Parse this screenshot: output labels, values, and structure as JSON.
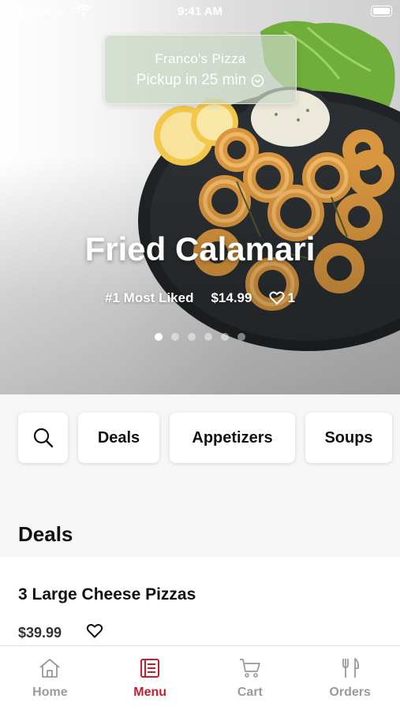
{
  "status_bar": {
    "carrier": "Carrier",
    "time": "9:41 AM"
  },
  "restaurant": {
    "name": "Franco's Pizza",
    "pickup": "Pickup in 25 min"
  },
  "hero": {
    "title": "Fried Calamari",
    "badge": "#1 Most Liked",
    "price": "$14.99",
    "likes": "1",
    "dots": 6,
    "active_dot": 0
  },
  "categories": [
    {
      "icon": "search-icon"
    },
    {
      "label": "Deals"
    },
    {
      "label": "Appetizers"
    },
    {
      "label": "Soups"
    }
  ],
  "section": {
    "title": "Deals"
  },
  "items": [
    {
      "name": "3 Large Cheese Pizzas",
      "price": "$39.99"
    }
  ],
  "tabs": [
    {
      "label": "Home",
      "icon": "home-icon"
    },
    {
      "label": "Menu",
      "icon": "menu-icon",
      "active": true
    },
    {
      "label": "Cart",
      "icon": "cart-icon"
    },
    {
      "label": "Orders",
      "icon": "fork-knife-icon"
    }
  ],
  "colors": {
    "accent": "#c3202e",
    "inactive": "#9a9a9a"
  }
}
